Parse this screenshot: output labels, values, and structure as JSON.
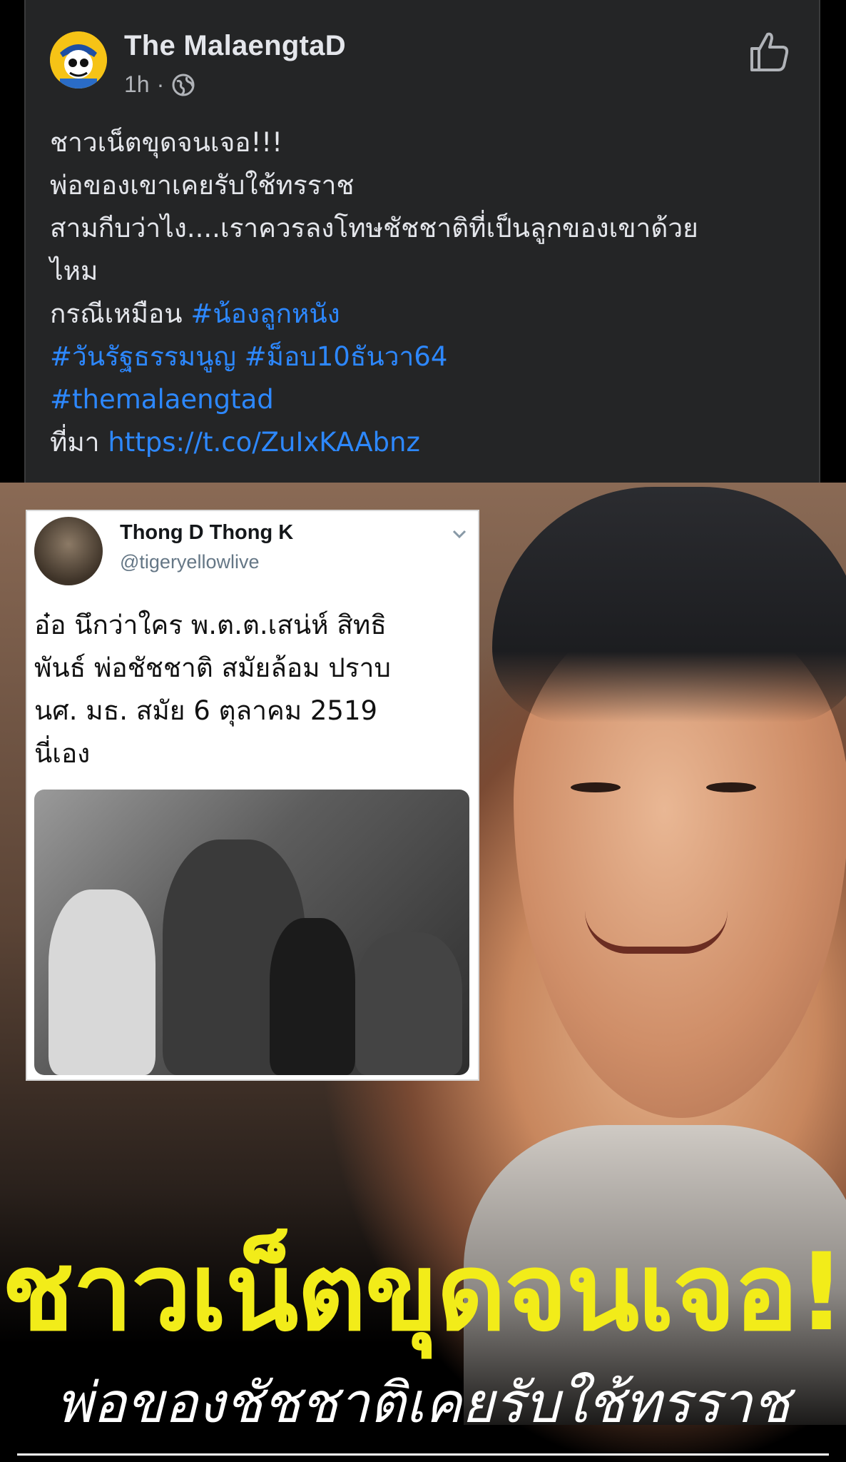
{
  "post": {
    "author": "The MalaengtaD",
    "time": "1h",
    "separator": "·",
    "avatar_icon": "cartoon-avatar-icon",
    "privacy_icon": "globe-icon",
    "like_icon": "thumbs-up-icon",
    "text_lines": [
      "ชาวเน็ตขุดจนเจอ!!!",
      "พ่อของเขาเคยรับใช้ทรราช",
      "สามกีบว่าไง....เราควรลงโทษชัชชาติที่เป็นลูกของเขาด้วย",
      "ไหม"
    ],
    "case_prefix": "กรณีเหมือน ",
    "hashtags": [
      "#น้องลูกหนัง",
      "#วันรัฐธรรมนูญ",
      "#ม็อบ10ธันวา64",
      "#themalaengtad"
    ],
    "source_prefix": "ที่มา ",
    "source_link": "https://t.co/ZuIxKAAbnz",
    "link_color": "#2d88ff"
  },
  "image": {
    "tweet": {
      "name": "Thong D Thong K",
      "handle": "@tigeryellowlive",
      "chevron_icon": "chevron-down-icon",
      "text_lines": [
        "อ๋อ นึกว่าใคร พ.ต.ต.เสน่ห์ สิทธิ",
        "พันธ์ พ่อชัชชาติ  สมัยล้อม ปราบ",
        "นศ. มธ. สมัย 6 ตุลาคม 2519",
        "นี่เอง"
      ]
    },
    "headline": "ชาวเน็ตขุดจนเจอ!",
    "subheadline": "พ่อของชัชชาติเคยรับใช้ทรราช",
    "headline_color": "#f2ec19"
  }
}
